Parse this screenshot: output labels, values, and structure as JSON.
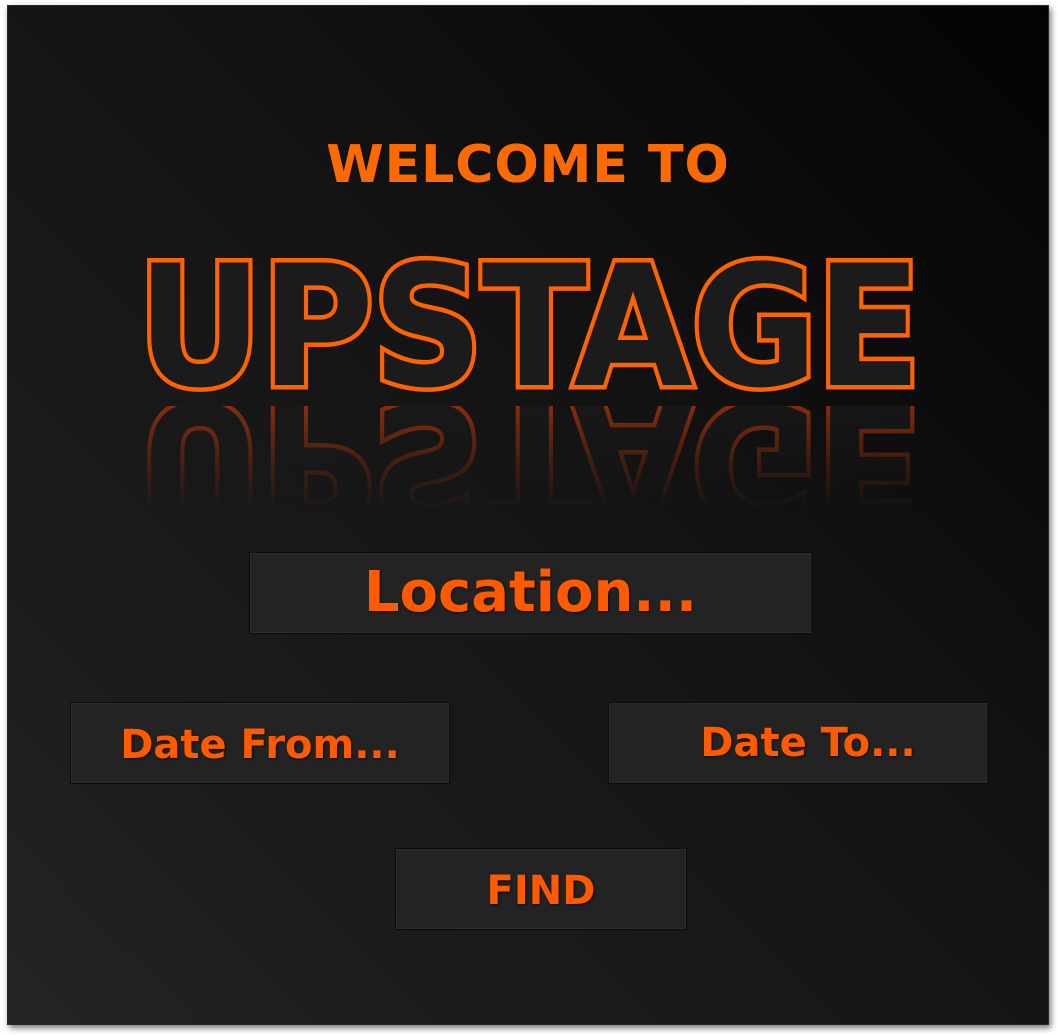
{
  "header": {
    "welcome": "WELCOME TO",
    "title": "UPSTAGE"
  },
  "form": {
    "location_placeholder": "Location...",
    "date_from_placeholder": "Date From...",
    "date_to_placeholder": "Date To...",
    "find_label": "FIND"
  },
  "colors": {
    "accent": "#ff6200",
    "background": "#141414",
    "field": "#232323"
  }
}
